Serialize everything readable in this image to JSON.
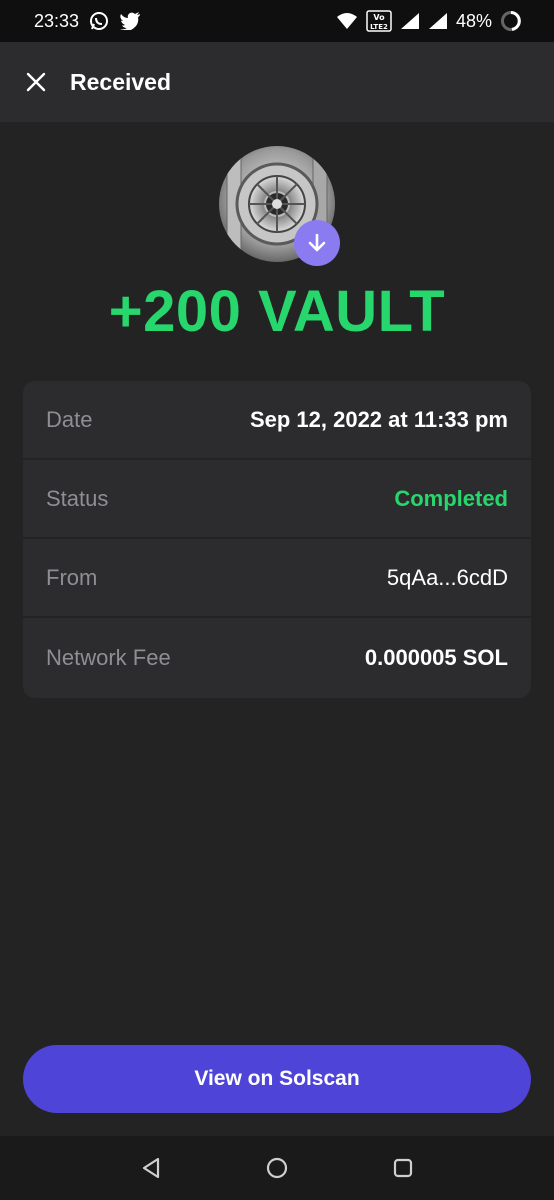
{
  "status_bar": {
    "time": "23:33",
    "battery_percent": "48%",
    "volte_label": "Vo LTE 2",
    "notification_icons": [
      "whatsapp-icon",
      "twitter-icon"
    ],
    "system_icons": [
      "wifi-icon",
      "volte-icon",
      "signal-icon",
      "signal-icon",
      "battery-icon"
    ]
  },
  "header": {
    "title": "Received",
    "close_icon": "close-icon"
  },
  "token": {
    "avatar": "vault-token-logo",
    "badge_icon": "arrow-down-icon",
    "amount": "+200 VAULT"
  },
  "details": {
    "rows": [
      {
        "label": "Date",
        "value": "Sep 12, 2022 at 11:33 pm"
      },
      {
        "label": "Status",
        "value": "Completed"
      },
      {
        "label": "From",
        "value": "5qAa...6cdD"
      },
      {
        "label": "Network Fee",
        "value": "0.000005 SOL"
      }
    ]
  },
  "actions": {
    "solscan_label": "View on Solscan"
  },
  "nav": {
    "items": [
      "back-icon",
      "home-icon",
      "recents-icon"
    ]
  },
  "colors": {
    "background": "#232323",
    "card": "#2c2c2e",
    "accent_green": "#27d66c",
    "button_purple": "#4f44d8",
    "badge_purple": "#8a7cf0",
    "muted_text": "#8e8e93"
  }
}
